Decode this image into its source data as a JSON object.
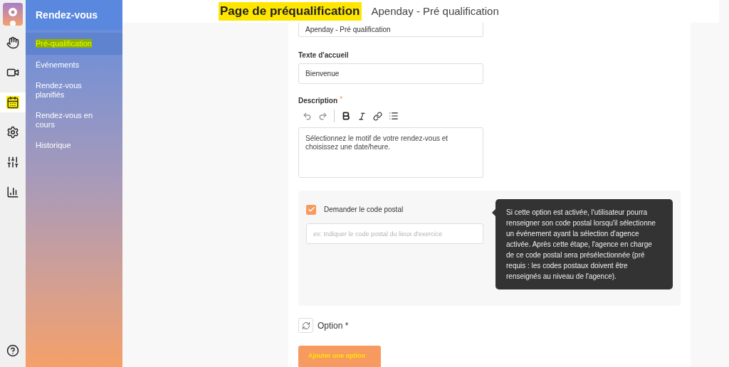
{
  "rail": [
    {
      "selected": false
    },
    {
      "selected": false
    },
    {
      "selected": true
    },
    {
      "selected": false
    },
    {
      "selected": false
    },
    {
      "selected": false
    }
  ],
  "nav": {
    "title": "Rendez-vous",
    "items": [
      {
        "label": "Pré-qualification",
        "selected": true
      },
      {
        "label": "Événements",
        "selected": false
      },
      {
        "label": "Rendez-vous planifiés",
        "selected": false
      },
      {
        "label": "Rendez-vous en cours",
        "selected": false
      },
      {
        "label": "Historique",
        "selected": false
      }
    ]
  },
  "header": {
    "title": "Page de préqualification",
    "subtitle": "Apenday - Pré qualification"
  },
  "form": {
    "name_value": "Apenday - Pré qualification",
    "welcome": {
      "label": "Texte d'accueil",
      "value": "Bienvenue"
    },
    "description": {
      "label": "Description",
      "required": "*",
      "value": "Sélectionnez le motif de votre rendez-vous et choisissez une date/heure."
    },
    "postal": {
      "label": "Demander le code postal",
      "checked": true,
      "placeholder": "ex: Indiquer le code postal du lieux d'exercice",
      "tooltip": "Si cette option est activée, l'utilisateur pourra renseigner son code postal lorsqu'il sélectionne un événement ayant la sélection d'agence activée. Après cette étape, l'agence en charge de ce code postal sera présélectionnée (pré requis : les codes postaux doivent être renseignés au niveau de l'agence)."
    },
    "option_label": "Option *",
    "add_button": "Ajouter une option"
  }
}
